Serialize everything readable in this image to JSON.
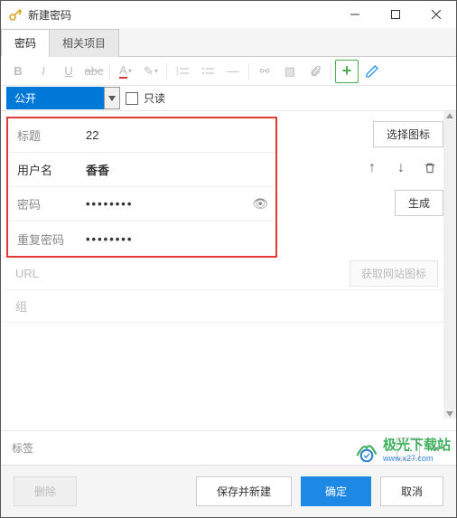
{
  "window": {
    "title": "新建密码"
  },
  "tabs": {
    "password": "密码",
    "related": "相关项目"
  },
  "toolbar": {
    "b": "B",
    "i": "I",
    "u": "U",
    "abc": "abc",
    "a": "A",
    "brush": "✎",
    "ol": "≡",
    "ul": "≡",
    "sep": "—",
    "link": "⚯",
    "img": "▧",
    "attach": "📎",
    "add": "+",
    "pencil": "✎"
  },
  "controls": {
    "visibility": "公开",
    "readonly_label": "只读"
  },
  "form": {
    "title_label": "标题",
    "title_value": "22",
    "user_label": "用户名",
    "user_value": "香香",
    "pwd_label": "密码",
    "pwd_value": "••••••••",
    "pwd2_label": "重复密码",
    "pwd2_value": "••••••••",
    "url_label": "URL",
    "group_label": "组"
  },
  "actions": {
    "choose_icon": "选择图标",
    "generate": "生成",
    "fetch_site_icon": "获取网站图标"
  },
  "tag": {
    "label": "标签",
    "more": "..."
  },
  "footer": {
    "delete": "删除",
    "save_new": "保存并新建",
    "ok": "确定",
    "cancel": "取消"
  },
  "watermark": {
    "name": "极光下载站",
    "url": "www.x27.com"
  }
}
